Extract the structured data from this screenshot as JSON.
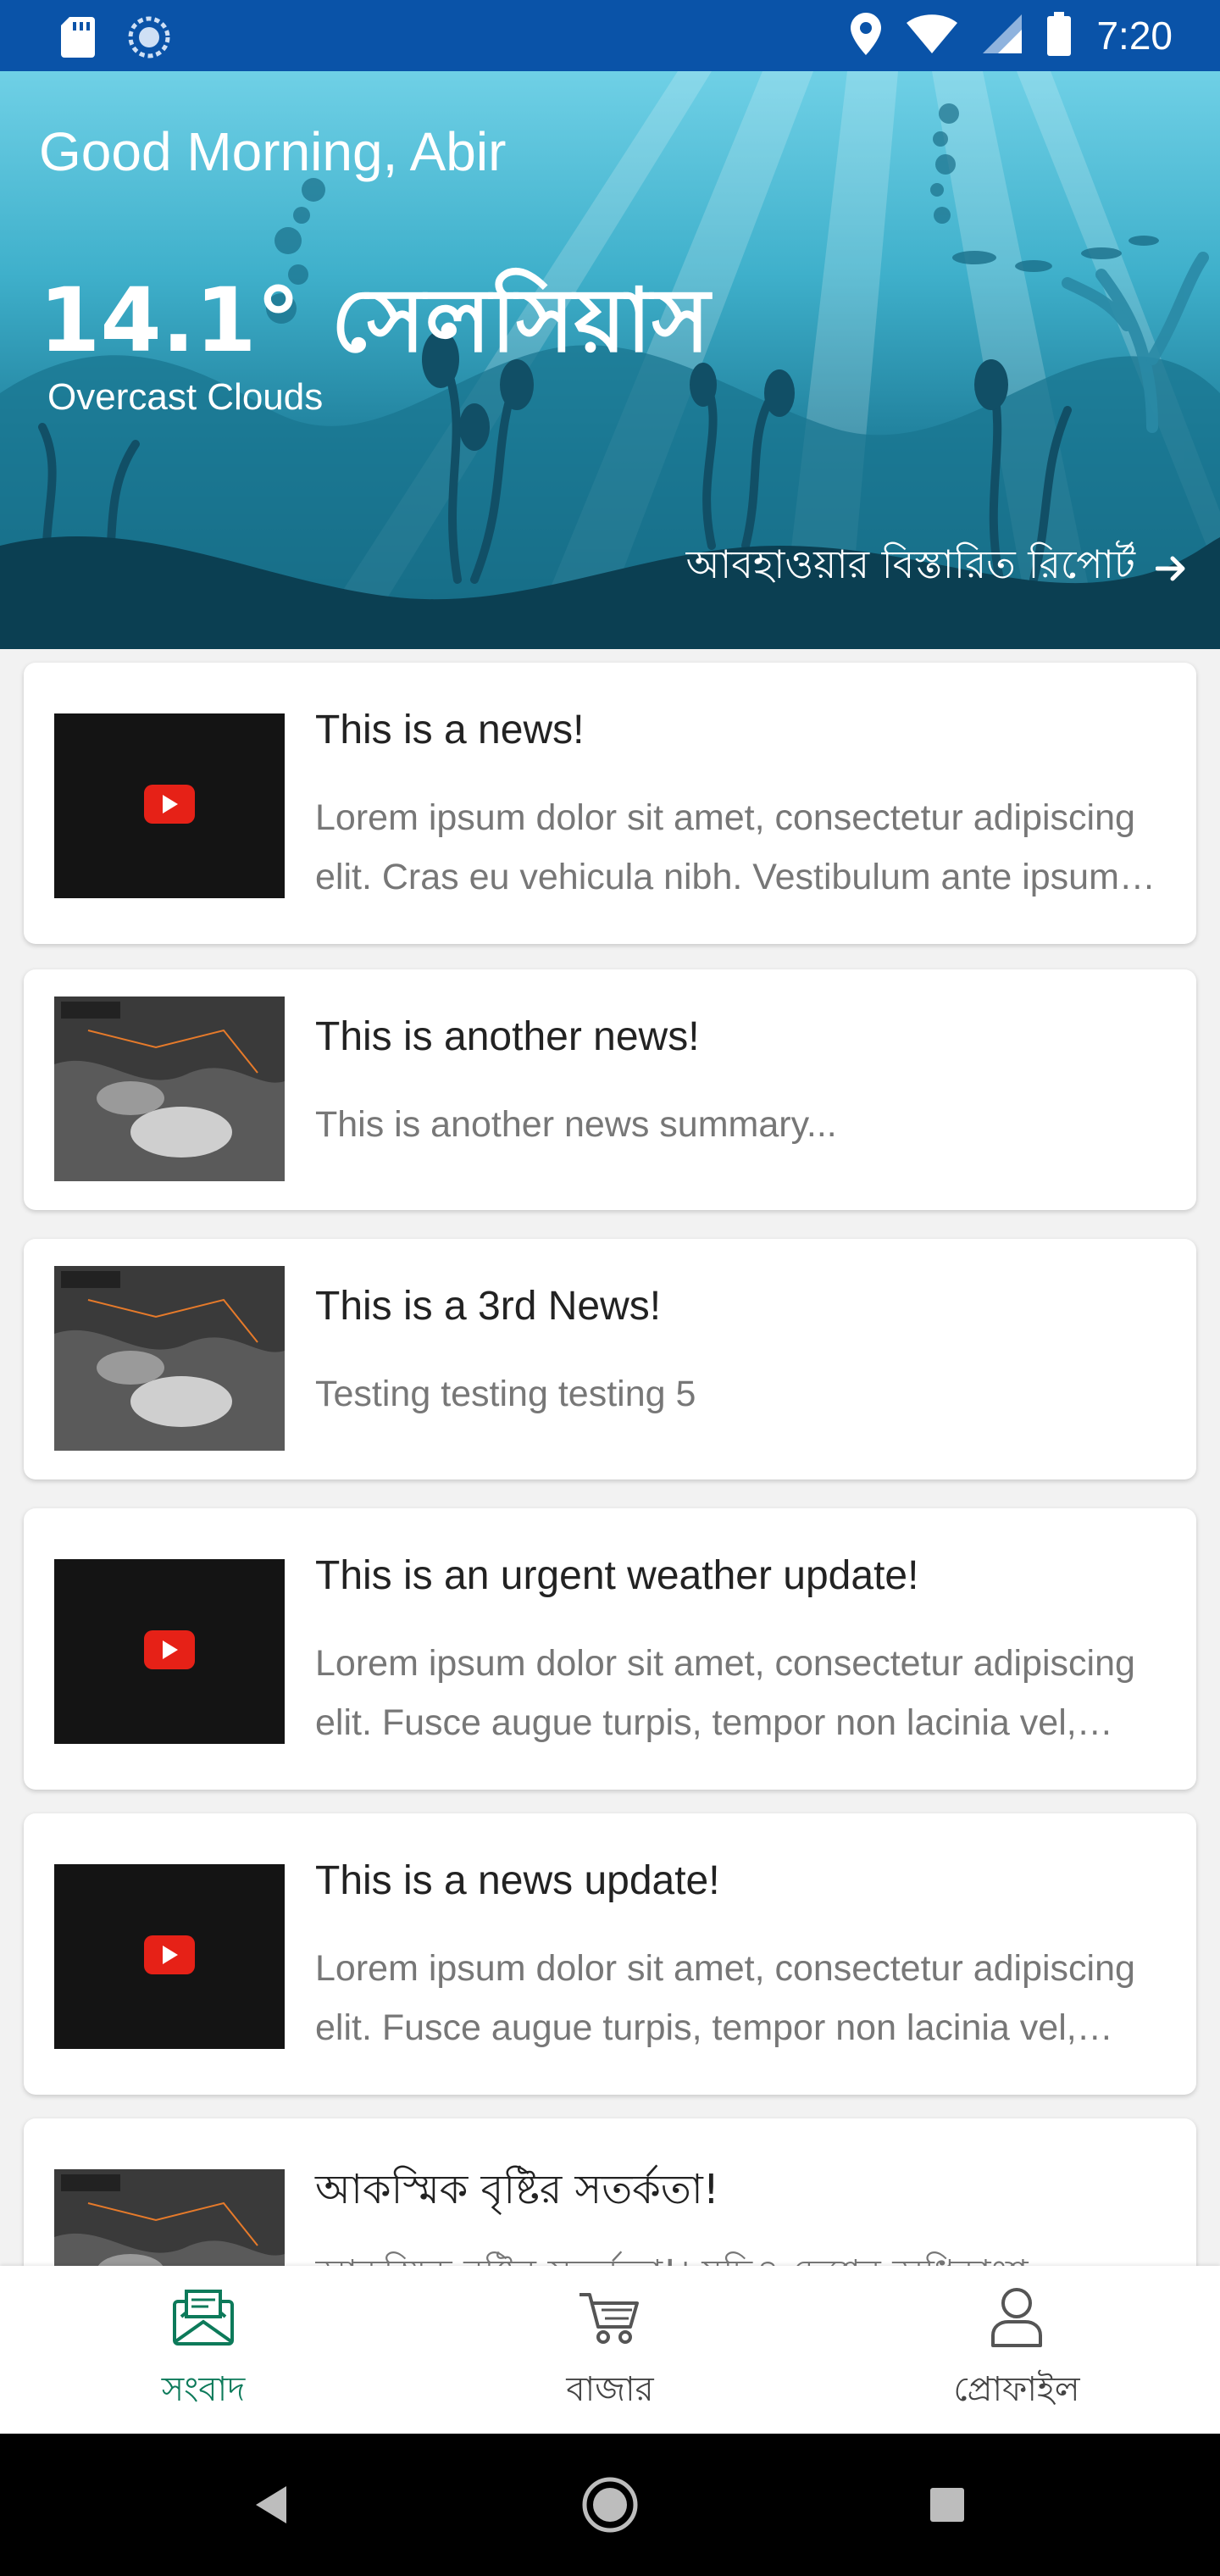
{
  "status_bar": {
    "time": "7:20",
    "left_icons": [
      "sd-card-icon",
      "sync-icon"
    ],
    "right_icons": [
      "location-icon",
      "wifi-icon",
      "signal-icon",
      "battery-icon"
    ],
    "background": "#0a53a8"
  },
  "hero": {
    "greeting": "Good Morning, Abir",
    "temperature": "14.1° সেলসিয়াস",
    "condition": "Overcast Clouds",
    "report_link": "আবহাওয়ার বিস্তারিত রিপোর্ট"
  },
  "news": [
    {
      "title": "This is a news!",
      "summary": "Lorem ipsum dolor sit amet, consectetur adipiscing elit. Cras eu vehicula nibh. Vestibulum ante ipsum primis in faucibus.",
      "thumbnail": "video"
    },
    {
      "title": "This is another news!",
      "summary": "This is another news summary...",
      "thumbnail": "satellite"
    },
    {
      "title": "This is a 3rd News!",
      "summary": "Testing testing testing 5",
      "thumbnail": "satellite"
    },
    {
      "title": "This is an urgent weather update!",
      "summary": "Lorem ipsum dolor sit amet, consectetur adipiscing elit. Fusce augue turpis, tempor non lacinia vel, ultricies nec lorem.",
      "thumbnail": "video"
    },
    {
      "title": "This is a news update!",
      "summary": "Lorem ipsum dolor sit amet, consectetur adipiscing elit. Fusce augue turpis, tempor non lacinia vel, ultricies nec lorem.",
      "thumbnail": "video"
    },
    {
      "title": "আকস্মিক বৃষ্টির সতর্কতা!",
      "summary": "আকস্মিক বৃষ্টির সতর্কতা!। যদিও দেশের অধিকাংশ",
      "thumbnail": "satellite"
    }
  ],
  "bottom_nav": {
    "items": [
      {
        "label": "সংবাদ",
        "icon": "news-icon",
        "active": true
      },
      {
        "label": "বাজার",
        "icon": "cart-icon",
        "active": false
      },
      {
        "label": "প্রোফাইল",
        "icon": "profile-icon",
        "active": false
      }
    ],
    "active_color": "#0d7a5a"
  }
}
